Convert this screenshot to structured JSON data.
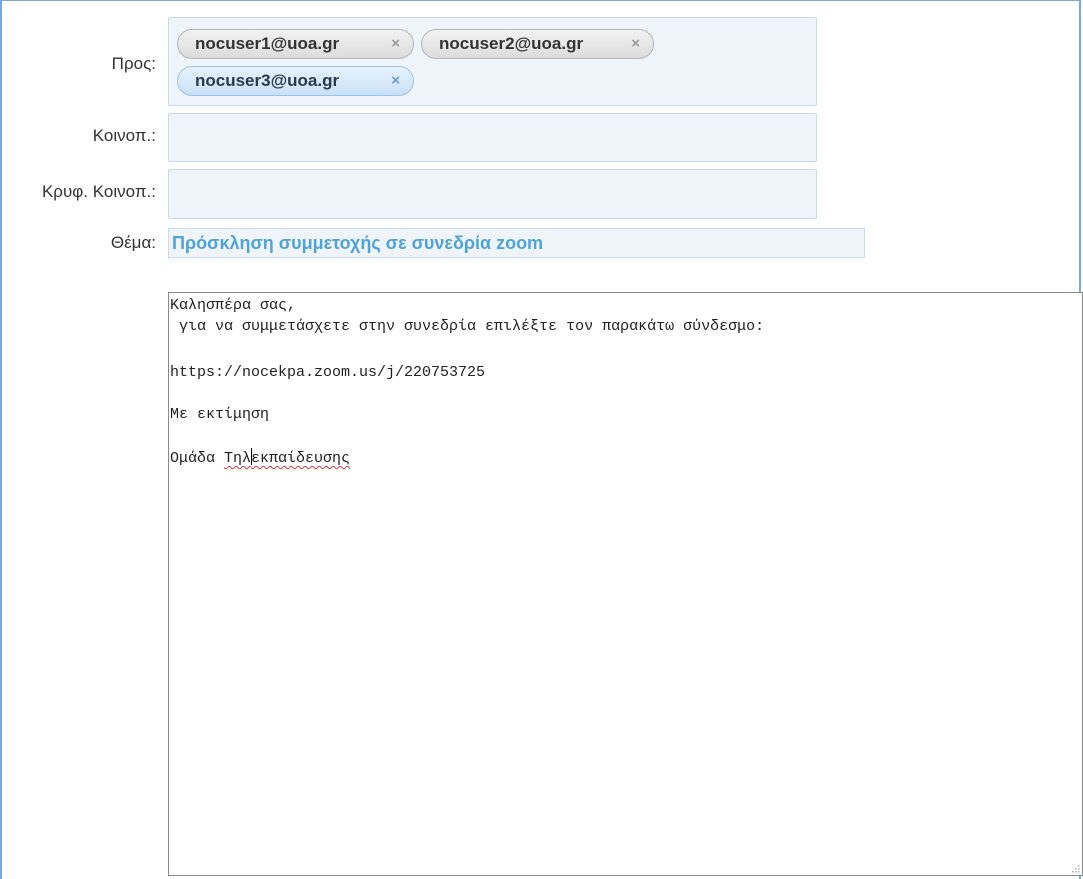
{
  "to": {
    "label": "Προς:",
    "recipients": [
      {
        "email": "nocuser1@uoa.gr",
        "remove": "×"
      },
      {
        "email": "nocuser2@uoa.gr",
        "remove": "×"
      },
      {
        "email": "nocuser3@uoa.gr",
        "remove": "×"
      }
    ]
  },
  "cc": {
    "label": "Κοινοπ.:",
    "value": ""
  },
  "bcc": {
    "label": "Κρυφ. Κοινοπ.:",
    "value": ""
  },
  "subject": {
    "label": "Θέμα:",
    "value": "Πρόσκληση συμμετοχής σε συνεδρία zoom"
  },
  "message": {
    "lines": [
      "Καλησπέρα σας,",
      " για να συμμετάσχετε στην συνεδρία επιλέξτε τον παρακάτω σύνδεσμο:",
      "",
      "https://nocekpa.zoom.us/j/220753725",
      "",
      "Με εκτίμηση",
      "",
      "Ομάδα Τηλεκπαίδευσης"
    ],
    "signature_prefix": "Ομάδα ",
    "misspelled_before_caret": "Τηλ",
    "misspelled_after_caret": "εκπαίδευσης"
  },
  "colors": {
    "field_bg": "#eef4fa",
    "subject_text": "#4fa3d6",
    "frame_border": "#7aa8d9"
  }
}
